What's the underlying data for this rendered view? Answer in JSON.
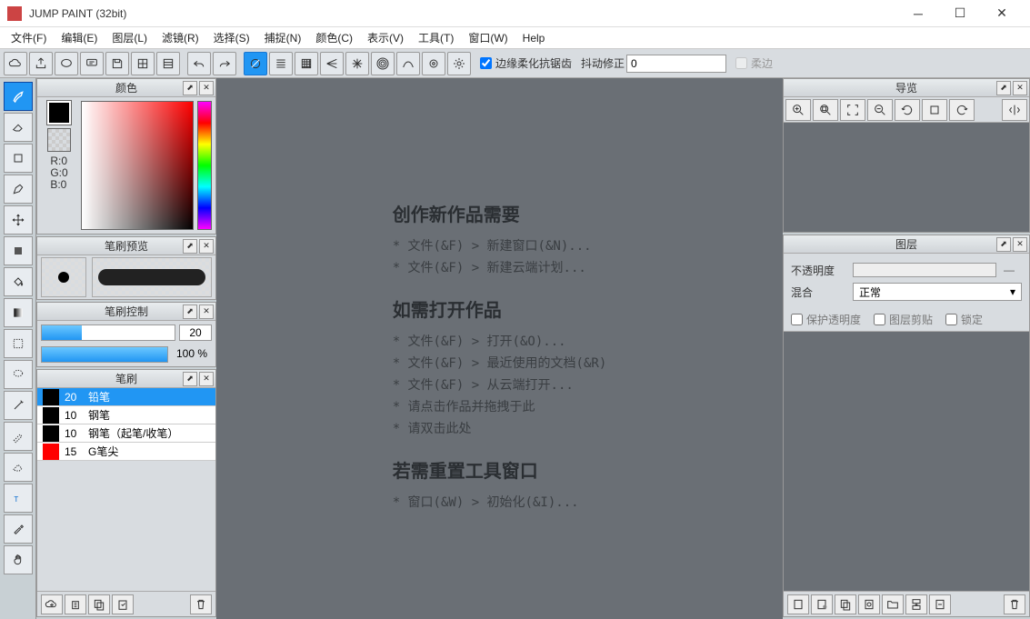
{
  "title": "JUMP PAINT (32bit)",
  "menu": [
    "文件(F)",
    "编辑(E)",
    "图层(L)",
    "滤镜(R)",
    "选择(S)",
    "捕捉(N)",
    "颜色(C)",
    "表示(V)",
    "工具(T)",
    "窗口(W)",
    "Help"
  ],
  "toolbar": {
    "antialias": "边缘柔化抗锯齿",
    "shake": "抖动修正",
    "shake_val": "0",
    "soft": "柔边"
  },
  "panels": {
    "color": {
      "title": "颜色",
      "r": "R:0",
      "g": "G:0",
      "b": "B:0"
    },
    "brush_preview": {
      "title": "笔刷预览"
    },
    "brush_control": {
      "title": "笔刷控制",
      "v1": "20",
      "v2": "100 %"
    },
    "brush": {
      "title": "笔刷",
      "items": [
        {
          "size": "20",
          "name": "铅笔",
          "color": "#000",
          "active": true
        },
        {
          "size": "10",
          "name": "钢笔",
          "color": "#000"
        },
        {
          "size": "10",
          "name": "钢笔（起笔/收笔）",
          "color": "#000"
        },
        {
          "size": "15",
          "name": "G笔尖",
          "color": "#f00"
        }
      ]
    },
    "nav": {
      "title": "导览"
    },
    "layer": {
      "title": "图层",
      "opacity": "不透明度",
      "blend": "混合",
      "blend_val": "正常",
      "checks": [
        "保护透明度",
        "图层剪贴",
        "锁定"
      ]
    }
  },
  "welcome": {
    "h1": "创作新作品需要",
    "l1": "* 文件(&F) > 新建窗口(&N)...",
    "l2": "* 文件(&F) > 新建云端计划...",
    "h2": "如需打开作品",
    "l3": "* 文件(&F) > 打开(&O)...",
    "l4": "* 文件(&F) > 最近使用的文档(&R)",
    "l5": "* 文件(&F) > 从云端打开...",
    "l6": "* 请点击作品并拖拽于此",
    "l7": "* 请双击此处",
    "h3": "若需重置工具窗口",
    "l8": "* 窗口(&W) > 初始化(&I)..."
  }
}
